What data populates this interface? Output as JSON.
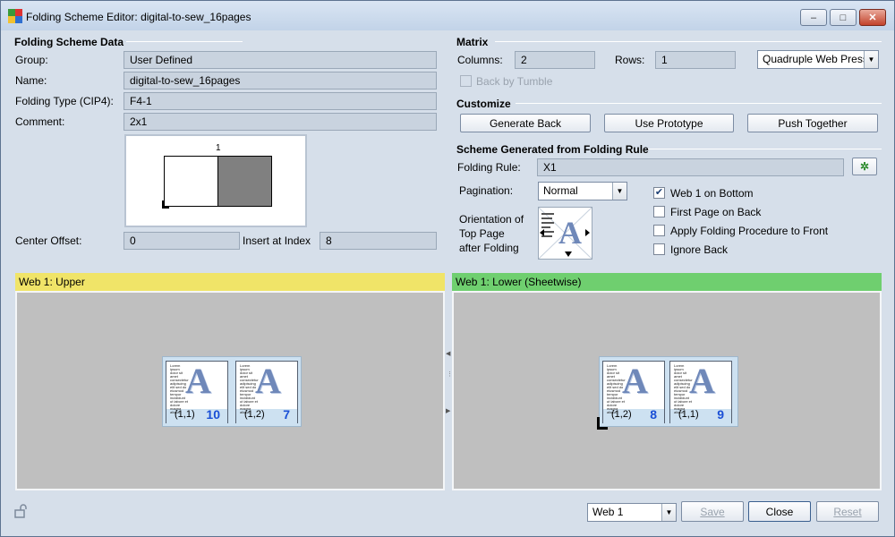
{
  "window": {
    "title": "Folding Scheme Editor: digital-to-sew_16pages",
    "controls": {
      "minimize": "–",
      "maximize": "□",
      "close": "✕"
    }
  },
  "folding_scheme_data": {
    "section_title": "Folding Scheme Data",
    "group_label": "Group:",
    "group_value": "User Defined",
    "name_label": "Name:",
    "name_value": "digital-to-sew_16pages",
    "folding_type_label": "Folding Type (CIP4):",
    "folding_type_value": "F4-1",
    "comment_label": "Comment:",
    "comment_value": "2x1",
    "preview_column_label": "1",
    "center_offset_label": "Center Offset:",
    "center_offset_value": "0",
    "insert_at_index_label": "Insert at Index",
    "insert_at_index_value": "8"
  },
  "matrix": {
    "section_title": "Matrix",
    "columns_label": "Columns:",
    "columns_value": "2",
    "rows_label": "Rows:",
    "rows_value": "1",
    "web_type": "Quadruple Web Press",
    "back_by_tumble_label": "Back by Tumble",
    "back_by_tumble_checked": false
  },
  "customize": {
    "section_title": "Customize",
    "generate_back": "Generate Back",
    "use_prototype": "Use Prototype",
    "push_together": "Push Together"
  },
  "scheme_rule": {
    "section_title": "Scheme Generated from Folding Rule",
    "folding_rule_label": "Folding Rule:",
    "folding_rule_value": "X1",
    "pagination_label": "Pagination:",
    "pagination_value": "Normal",
    "orientation_line1": "Orientation of",
    "orientation_line2": "Top Page",
    "orientation_line3": "after Folding",
    "options": [
      {
        "label": "Web 1 on Bottom",
        "checked": true
      },
      {
        "label": "First Page on Back",
        "checked": false
      },
      {
        "label": "Apply Folding Procedure to Front",
        "checked": false
      },
      {
        "label": "Ignore Back",
        "checked": false
      }
    ]
  },
  "panels": {
    "upper": {
      "title": "Web 1: Upper",
      "color": "#f0e468",
      "pages": [
        {
          "pos": "(1,1)",
          "num": "10"
        },
        {
          "pos": "(1,2)",
          "num": "7"
        }
      ]
    },
    "lower": {
      "title": "Web 1: Lower (Sheetwise)",
      "color": "#6fcf6f",
      "pages": [
        {
          "pos": "(1,2)",
          "num": "8"
        },
        {
          "pos": "(1,1)",
          "num": "9"
        }
      ]
    }
  },
  "footer": {
    "web_select": "Web 1",
    "save": "Save",
    "close": "Close",
    "reset": "Reset"
  },
  "page_sample_text": "Lorem ipsum dolor sit amet consectetur adipiscing elit sed do eiusmod tempor incididunt ut labore et dolore magna aliqua"
}
